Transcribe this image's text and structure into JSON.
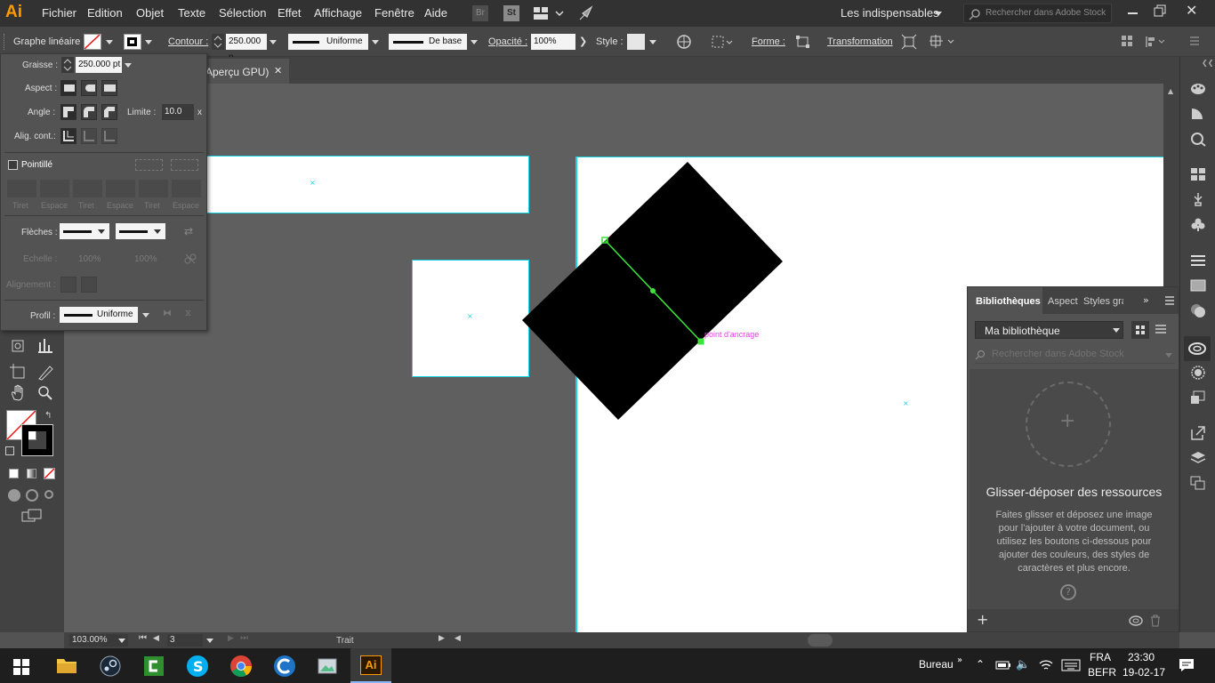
{
  "menubar": {
    "app_logo": "Ai",
    "items": [
      "Fichier",
      "Edition",
      "Objet",
      "Texte",
      "Sélection",
      "Effet",
      "Affichage",
      "Fenêtre",
      "Aide"
    ],
    "bridge": "Br",
    "stock": "St",
    "workspace": "Les indispensables",
    "search_placeholder": "Rechercher dans Adobe Stock"
  },
  "options": {
    "object_type": "Graphe linéaire",
    "contour_label": "Contour :",
    "contour_value": "250.000 p",
    "stroke_profile": "Uniforme",
    "brush": "De base",
    "opacity_label": "Opacité :",
    "opacity_value": "100%",
    "style_label": "Style :",
    "forme_label": "Forme :",
    "transformation_label": "Transformation"
  },
  "document": {
    "tab_title": "Aperçu GPU)"
  },
  "stroke_panel": {
    "graisse_label": "Graisse :",
    "graisse_value": "250.000 pt",
    "aspect_label": "Aspect :",
    "angle_label": "Angle :",
    "limite_label": "Limite :",
    "limite_value": "10.0",
    "limite_unit": "x",
    "align_label": "Alig. cont.:",
    "pointille_label": "Pointillé",
    "dash_labels": [
      "Tiret",
      "Espace",
      "Tiret",
      "Espace",
      "Tiret",
      "Espace"
    ],
    "fleches_label": "Flèches :",
    "echelle_label": "Echelle :",
    "echelle_val1": "100%",
    "echelle_val2": "100%",
    "alignement_label": "Alignement :",
    "profil_label": "Profil :",
    "profil_value": "Uniforme"
  },
  "canvas": {
    "anchor_hint": "point d'ancrage"
  },
  "libraries": {
    "tabs": [
      "Bibliothèques",
      "Aspect",
      "Styles gra"
    ],
    "library_name": "Ma bibliothèque",
    "search_placeholder": "Rechercher dans Adobe Stock",
    "drop_title": "Glisser-déposer des ressources",
    "drop_text": "Faites glisser et déposez une image pour l'ajouter à votre document, ou utilisez les boutons ci-dessous pour ajouter des couleurs, des styles de caractères et plus encore.",
    "help": "?"
  },
  "statusbar": {
    "zoom": "103.00%",
    "page": "3",
    "mode": "Trait"
  },
  "taskbar": {
    "bureau": "Bureau",
    "lang1": "FRA",
    "lang2": "BEFR",
    "time": "23:30",
    "date": "19-02-17",
    "ai_label": "Ai"
  },
  "colors": {
    "accent": "#ff9a00",
    "guide": "#19d4e6",
    "path": "#39e639",
    "hint": "#e83ee8"
  }
}
